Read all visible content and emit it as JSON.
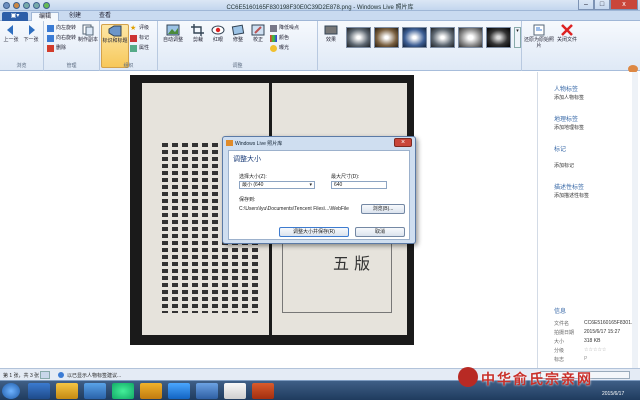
{
  "window": {
    "title": "CC6E5160165F830198F30E0C39D2E878.png - Windows Live 照片库",
    "min": "–",
    "max": "□",
    "close": "x"
  },
  "menu": {
    "file": "▣▾"
  },
  "tabs": [
    "编辑",
    "创建",
    "查看"
  ],
  "ribbon": {
    "nav": {
      "prev": "上一张",
      "next": "下一张",
      "group": "浏览"
    },
    "manage": {
      "rotate_left": "向左旋转",
      "rotate_right": "向右旋转",
      "delete": "删除",
      "copy": "制作副本",
      "group": "管理"
    },
    "organize": {
      "tag": "标识和标题",
      "rate": "评级",
      "flag": "标记",
      "props": "属性",
      "group": "组织"
    },
    "adjust": {
      "auto": "自动调整",
      "crop": "剪裁",
      "redeye": "红眼",
      "straighten": "修整",
      "retouch": "校正",
      "noise": "降低噪点",
      "color": "颜色",
      "exposure": "曝光",
      "effects": "效果",
      "group": "调整"
    },
    "revert": "还原为原始照片",
    "close": "关闭文件"
  },
  "dialog": {
    "title": "Windows Live 照片库",
    "heading": "调整大小",
    "size_label": "选择大小(Z):",
    "size_value": "最小 (640",
    "max_label": "最大尺寸(D):",
    "max_value": "640",
    "save_label": "保存到:",
    "save_path": "C:\\Users\\lyu\\Documents\\Tencent Files\\...\\WebFile",
    "browse": "浏览(B)...",
    "resize": "调整大小并保存(R)",
    "cancel": "取消"
  },
  "rpanel": {
    "people_head": "人物标签",
    "people_link": "添加人物标签",
    "geo_head": "地理标签",
    "geo_link": "添加地理标签",
    "tags_head": "标记",
    "tags_link": "添加标记",
    "desc_head": "描述性标签",
    "desc_link": "添加描述性标签",
    "info_head": "信息",
    "info": [
      {
        "k": "文件名",
        "v": "CC6E5160165F8301..."
      },
      {
        "k": "拍摄日期",
        "v": "2015/6/17   15:27"
      },
      {
        "k": "大小",
        "v": "318 KB"
      },
      {
        "k": "分级",
        "v": "☆☆☆☆☆"
      },
      {
        "k": "标志",
        "v": "P"
      }
    ]
  },
  "status": {
    "count": "第 1 张，共 3 张",
    "hint": "以已显示人物标签建议..."
  },
  "watermark": {
    "text": "中华俞氏宗亲网",
    "date": "2015/6/17"
  },
  "book": {
    "stamp": "五 版"
  }
}
